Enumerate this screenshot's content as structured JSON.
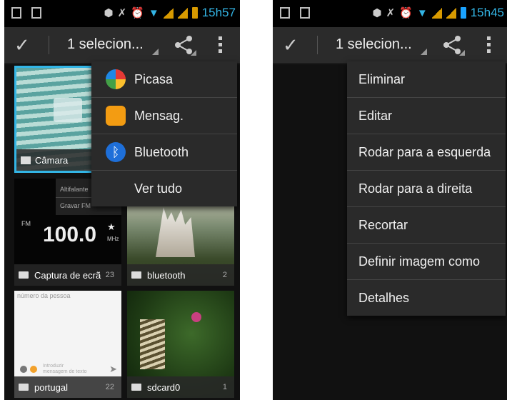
{
  "left": {
    "status": {
      "time": "15h57"
    },
    "actionbar": {
      "title": "1 selecion..."
    },
    "tiles": [
      {
        "name": "camera-album",
        "label": "Câmara",
        "count": ""
      },
      {
        "name": "screenshots-album",
        "label": "Captura de ecrã",
        "count": "23",
        "fm": {
          "frequency": "100.0",
          "unit": "MHz",
          "band": "FM",
          "menu1": "Altifalante",
          "menu2": "Gravar FM"
        }
      },
      {
        "name": "bluetooth-album",
        "label": "bluetooth",
        "count": "2"
      },
      {
        "name": "portugal-album",
        "label": "portugal",
        "count": "22",
        "sms": {
          "header": "número da pessoa",
          "hint1": "Introduzir",
          "hint2": "mensagem de texto"
        }
      },
      {
        "name": "sdcard-album",
        "label": "sdcard0",
        "count": "1"
      }
    ],
    "share_menu": [
      "Picasa",
      "Mensag.",
      "Bluetooth",
      "Ver tudo"
    ]
  },
  "right": {
    "status": {
      "time": "15h45"
    },
    "actionbar": {
      "title": "1 selecion..."
    },
    "menu": [
      "Eliminar",
      "Editar",
      "Rodar para a esquerda",
      "Rodar para a direita",
      "Recortar",
      "Definir imagem como",
      "Detalhes"
    ]
  },
  "colors": {
    "accent": "#33b5e5",
    "actionbar": "#2b2b2b",
    "menu": "#2a2a2a"
  }
}
